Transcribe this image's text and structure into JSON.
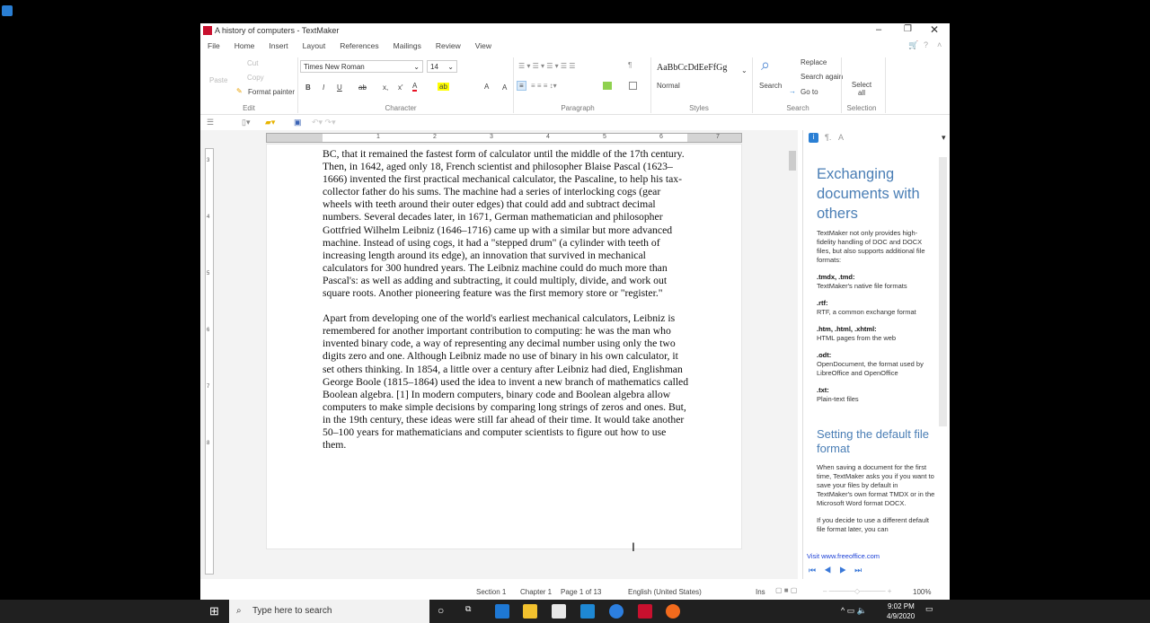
{
  "window": {
    "title": "A history of computers - TextMaker",
    "app_icon": "textmaker-icon"
  },
  "menu": [
    "File",
    "Home",
    "Insert",
    "Layout",
    "References",
    "Mailings",
    "Review",
    "View"
  ],
  "ribbon": {
    "edit": {
      "paste": "Paste",
      "cut": "Cut",
      "copy": "Copy",
      "format_painter": "Format painter",
      "label": "Edit"
    },
    "character": {
      "font": "Times New Roman",
      "size": "14",
      "bold": "B",
      "italic": "I",
      "underline": "U",
      "strike": "ab",
      "sub": "x,",
      "sup": "x'",
      "label": "Character",
      "font_color": "#e81123",
      "highlight_color": "#ffff00"
    },
    "paragraph": {
      "label": "Paragraph",
      "pilcrow": "¶"
    },
    "styles": {
      "preview": "AaBbCcDdEeFfGg",
      "current": "Normal",
      "label": "Styles"
    },
    "search": {
      "search": "Search",
      "replace": "Replace",
      "search_again": "Search again",
      "goto": "Go to",
      "label": "Search"
    },
    "selection": {
      "select_all": "Select all",
      "label": "Selection"
    }
  },
  "ruler": {
    "ticks": [
      "1",
      "2",
      "3",
      "4",
      "5",
      "6",
      "7"
    ]
  },
  "vruler": {
    "ticks": [
      "3",
      "4",
      "5",
      "6",
      "7",
      "8"
    ]
  },
  "document": {
    "paragraphs": [
      "BC, that it remained the fastest form of calculator until the middle of the 17th century. Then, in 1642, aged only 18, French scientist and philosopher Blaise Pascal (1623–1666) invented the first practical mechanical calculator, the Pascaline, to help his tax-collector father do his sums. The machine had a series of interlocking cogs (gear wheels with teeth around their outer edges) that could add and subtract decimal numbers. Several decades later, in 1671, German mathematician and philosopher Gottfried Wilhelm Leibniz (1646–1716) came up with a similar but more advanced machine. Instead of using cogs, it had a \"stepped drum\" (a cylinder with teeth of increasing length around its edge), an innovation that survived in mechanical calculators for 300 hundred years. The Leibniz machine could do much more than Pascal's: as well as adding and subtracting, it could multiply, divide, and work out square roots. Another pioneering feature was the first memory store or \"register.\"",
      "Apart from developing one of the world's earliest mechanical calculators, Leibniz is remembered for another important contribution to computing: he was the man who invented binary code, a way of representing any decimal number using only the two digits zero and one. Although Leibniz made no use of binary in his own calculator, it set others thinking. In 1854, a little over a century after Leibniz had died, Englishman George Boole (1815–1864) used the idea to invent a new branch of mathematics called Boolean algebra. [1] In modern computers, binary code and Boolean algebra allow computers to make simple decisions by comparing long strings of zeros and ones. But, in the 19th century, these ideas were still far ahead of their time. It would take another 50–100 years for mathematicians and computer scientists to figure out how to use them."
    ]
  },
  "panel": {
    "heading1": "Exchanging documents with others",
    "intro": "TextMaker not only provides high-fidelity handling of DOC and DOCX files, but also supports additional file formats:",
    "formats": [
      {
        "ext": ".tmdx, .tmd:",
        "desc": "TextMaker's native file formats"
      },
      {
        "ext": ".rtf:",
        "desc": "RTF, a common exchange format"
      },
      {
        "ext": ".htm, .html, .xhtml:",
        "desc": "HTML pages from the web"
      },
      {
        "ext": ".odt:",
        "desc": "OpenDocument, the format used by LibreOffice and OpenOffice"
      },
      {
        "ext": ".txt:",
        "desc": "Plain-text files"
      }
    ],
    "heading2": "Setting the default file format",
    "p2": "When saving a document for the first time, TextMaker asks you if you want to save your files by default in TextMaker's own format TMDX or in the Microsoft Word format DOCX.",
    "p3": "If you decide to use a different default file format later, you can",
    "link": "Visit www.freeoffice.com"
  },
  "status": {
    "section": "Section 1",
    "chapter": "Chapter 1",
    "page": "Page 1 of 13",
    "language": "English (United States)",
    "mode": "Ins",
    "zoom": "100%"
  },
  "taskbar": {
    "search_placeholder": "Type here to search",
    "time": "9:02 PM",
    "date": "4/9/2020"
  }
}
